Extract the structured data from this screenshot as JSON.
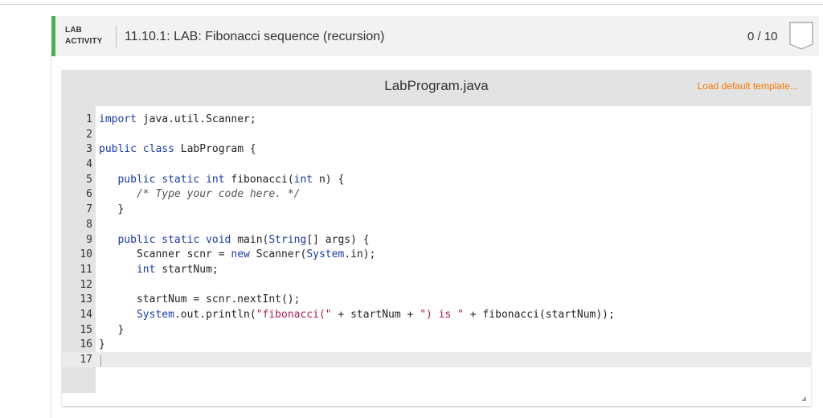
{
  "header": {
    "activity_type_line1": "LAB",
    "activity_type_line2": "ACTIVITY",
    "title": "11.10.1: LAB: Fibonacci sequence (recursion)",
    "score": "0 / 10",
    "accent_color": "#4caf50"
  },
  "editor": {
    "filename": "LabProgram.java",
    "load_template_label": "Load default template...",
    "load_template_color": "#f57c00",
    "lines": [
      {
        "num": "1",
        "text": "import java.util.Scanner;"
      },
      {
        "num": "2",
        "text": ""
      },
      {
        "num": "3",
        "text": "public class LabProgram {"
      },
      {
        "num": "4",
        "text": ""
      },
      {
        "num": "5",
        "text": "   public static int fibonacci(int n) {"
      },
      {
        "num": "6",
        "text": "      /* Type your code here. */"
      },
      {
        "num": "7",
        "text": "   }"
      },
      {
        "num": "8",
        "text": ""
      },
      {
        "num": "9",
        "text": "   public static void main(String[] args) {"
      },
      {
        "num": "10",
        "text": "      Scanner scnr = new Scanner(System.in);"
      },
      {
        "num": "11",
        "text": "      int startNum;"
      },
      {
        "num": "12",
        "text": ""
      },
      {
        "num": "13",
        "text": "      startNum = scnr.nextInt();"
      },
      {
        "num": "14",
        "text": "      System.out.println(\"fibonacci(\" + startNum + \") is \" + fibonacci(startNum));"
      },
      {
        "num": "15",
        "text": "   }"
      },
      {
        "num": "16",
        "text": "}"
      },
      {
        "num": "17",
        "text": ""
      }
    ]
  }
}
